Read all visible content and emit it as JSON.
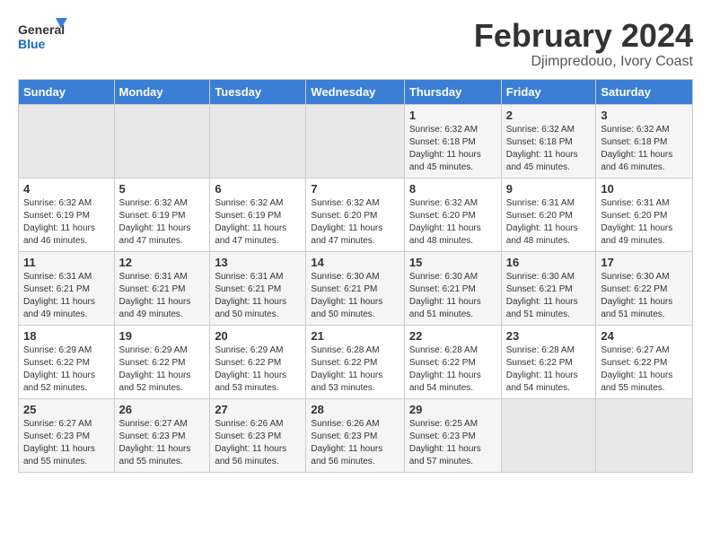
{
  "header": {
    "logo_line1": "General",
    "logo_line2": "Blue",
    "title": "February 2024",
    "subtitle": "Djimpredouo, Ivory Coast"
  },
  "calendar": {
    "days_of_week": [
      "Sunday",
      "Monday",
      "Tuesday",
      "Wednesday",
      "Thursday",
      "Friday",
      "Saturday"
    ],
    "weeks": [
      [
        {
          "day": "",
          "info": ""
        },
        {
          "day": "",
          "info": ""
        },
        {
          "day": "",
          "info": ""
        },
        {
          "day": "",
          "info": ""
        },
        {
          "day": "1",
          "info": "Sunrise: 6:32 AM\nSunset: 6:18 PM\nDaylight: 11 hours\nand 45 minutes."
        },
        {
          "day": "2",
          "info": "Sunrise: 6:32 AM\nSunset: 6:18 PM\nDaylight: 11 hours\nand 45 minutes."
        },
        {
          "day": "3",
          "info": "Sunrise: 6:32 AM\nSunset: 6:18 PM\nDaylight: 11 hours\nand 46 minutes."
        }
      ],
      [
        {
          "day": "4",
          "info": "Sunrise: 6:32 AM\nSunset: 6:19 PM\nDaylight: 11 hours\nand 46 minutes."
        },
        {
          "day": "5",
          "info": "Sunrise: 6:32 AM\nSunset: 6:19 PM\nDaylight: 11 hours\nand 47 minutes."
        },
        {
          "day": "6",
          "info": "Sunrise: 6:32 AM\nSunset: 6:19 PM\nDaylight: 11 hours\nand 47 minutes."
        },
        {
          "day": "7",
          "info": "Sunrise: 6:32 AM\nSunset: 6:20 PM\nDaylight: 11 hours\nand 47 minutes."
        },
        {
          "day": "8",
          "info": "Sunrise: 6:32 AM\nSunset: 6:20 PM\nDaylight: 11 hours\nand 48 minutes."
        },
        {
          "day": "9",
          "info": "Sunrise: 6:31 AM\nSunset: 6:20 PM\nDaylight: 11 hours\nand 48 minutes."
        },
        {
          "day": "10",
          "info": "Sunrise: 6:31 AM\nSunset: 6:20 PM\nDaylight: 11 hours\nand 49 minutes."
        }
      ],
      [
        {
          "day": "11",
          "info": "Sunrise: 6:31 AM\nSunset: 6:21 PM\nDaylight: 11 hours\nand 49 minutes."
        },
        {
          "day": "12",
          "info": "Sunrise: 6:31 AM\nSunset: 6:21 PM\nDaylight: 11 hours\nand 49 minutes."
        },
        {
          "day": "13",
          "info": "Sunrise: 6:31 AM\nSunset: 6:21 PM\nDaylight: 11 hours\nand 50 minutes."
        },
        {
          "day": "14",
          "info": "Sunrise: 6:30 AM\nSunset: 6:21 PM\nDaylight: 11 hours\nand 50 minutes."
        },
        {
          "day": "15",
          "info": "Sunrise: 6:30 AM\nSunset: 6:21 PM\nDaylight: 11 hours\nand 51 minutes."
        },
        {
          "day": "16",
          "info": "Sunrise: 6:30 AM\nSunset: 6:21 PM\nDaylight: 11 hours\nand 51 minutes."
        },
        {
          "day": "17",
          "info": "Sunrise: 6:30 AM\nSunset: 6:22 PM\nDaylight: 11 hours\nand 51 minutes."
        }
      ],
      [
        {
          "day": "18",
          "info": "Sunrise: 6:29 AM\nSunset: 6:22 PM\nDaylight: 11 hours\nand 52 minutes."
        },
        {
          "day": "19",
          "info": "Sunrise: 6:29 AM\nSunset: 6:22 PM\nDaylight: 11 hours\nand 52 minutes."
        },
        {
          "day": "20",
          "info": "Sunrise: 6:29 AM\nSunset: 6:22 PM\nDaylight: 11 hours\nand 53 minutes."
        },
        {
          "day": "21",
          "info": "Sunrise: 6:28 AM\nSunset: 6:22 PM\nDaylight: 11 hours\nand 53 minutes."
        },
        {
          "day": "22",
          "info": "Sunrise: 6:28 AM\nSunset: 6:22 PM\nDaylight: 11 hours\nand 54 minutes."
        },
        {
          "day": "23",
          "info": "Sunrise: 6:28 AM\nSunset: 6:22 PM\nDaylight: 11 hours\nand 54 minutes."
        },
        {
          "day": "24",
          "info": "Sunrise: 6:27 AM\nSunset: 6:22 PM\nDaylight: 11 hours\nand 55 minutes."
        }
      ],
      [
        {
          "day": "25",
          "info": "Sunrise: 6:27 AM\nSunset: 6:23 PM\nDaylight: 11 hours\nand 55 minutes."
        },
        {
          "day": "26",
          "info": "Sunrise: 6:27 AM\nSunset: 6:23 PM\nDaylight: 11 hours\nand 55 minutes."
        },
        {
          "day": "27",
          "info": "Sunrise: 6:26 AM\nSunset: 6:23 PM\nDaylight: 11 hours\nand 56 minutes."
        },
        {
          "day": "28",
          "info": "Sunrise: 6:26 AM\nSunset: 6:23 PM\nDaylight: 11 hours\nand 56 minutes."
        },
        {
          "day": "29",
          "info": "Sunrise: 6:25 AM\nSunset: 6:23 PM\nDaylight: 11 hours\nand 57 minutes."
        },
        {
          "day": "",
          "info": ""
        },
        {
          "day": "",
          "info": ""
        }
      ]
    ]
  }
}
